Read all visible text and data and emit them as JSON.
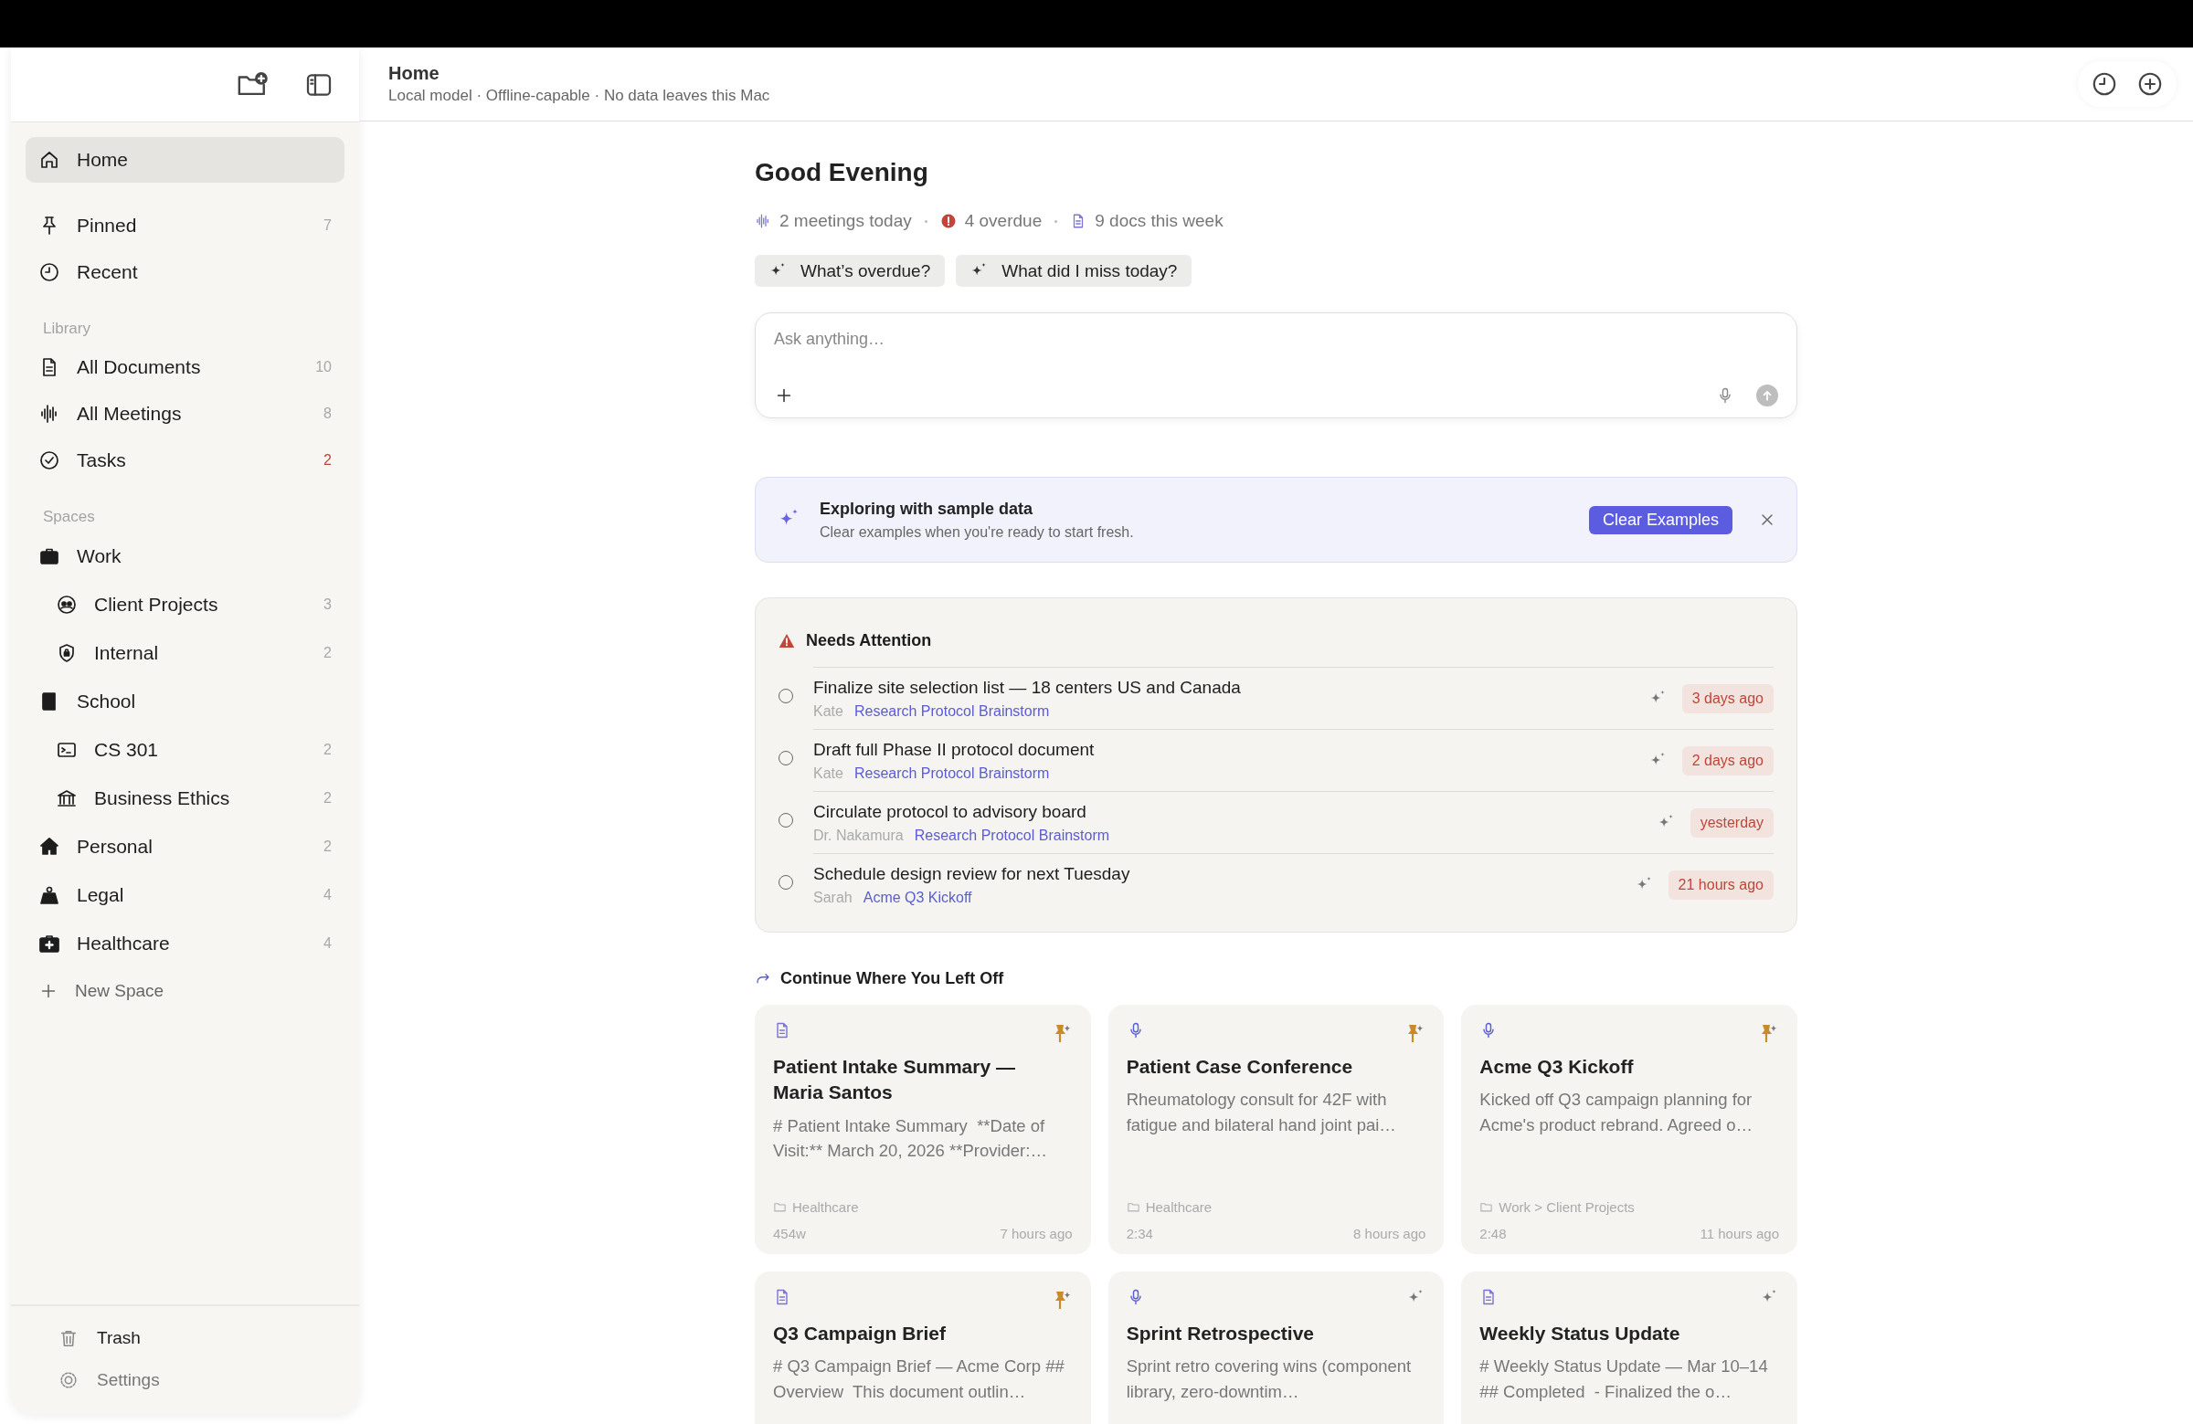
{
  "sidebar": {
    "nav": [
      {
        "label": "Home",
        "selected": true
      },
      {
        "label": "Pinned",
        "count": "7",
        "count_alert": false,
        "selected": false
      },
      {
        "label": "Recent",
        "selected": false
      }
    ],
    "sections": [
      {
        "title": "Library",
        "items": [
          {
            "label": "All Documents",
            "count": "10",
            "count_alert": false,
            "selected": false
          },
          {
            "label": "All Meetings",
            "count": "8",
            "count_alert": false,
            "selected": false
          },
          {
            "label": "Tasks",
            "count": "2",
            "count_alert": true,
            "selected": false
          }
        ]
      },
      {
        "title": "Spaces",
        "items": [
          {
            "label": "Work",
            "selected": false,
            "children": [
              {
                "label": "Client Projects",
                "count": "3",
                "count_alert": false,
                "selected": false
              },
              {
                "label": "Internal",
                "count": "2",
                "count_alert": false,
                "selected": false
              }
            ]
          },
          {
            "label": "School",
            "selected": false,
            "children": [
              {
                "label": "CS 301",
                "count": "2",
                "count_alert": false,
                "selected": false
              },
              {
                "label": "Business Ethics",
                "count": "2",
                "count_alert": false,
                "selected": false
              }
            ]
          },
          {
            "label": "Personal",
            "count": "2",
            "count_alert": false,
            "selected": false
          },
          {
            "label": "Legal",
            "count": "4",
            "count_alert": false,
            "selected": false
          },
          {
            "label": "Healthcare",
            "count": "4",
            "count_alert": false,
            "selected": false
          }
        ]
      }
    ],
    "new_space": "New Space",
    "footer": [
      {
        "label": "Trash"
      },
      {
        "label": "Settings"
      }
    ]
  },
  "header": {
    "title": "Home",
    "subtitle": "Local model · Offline-capable · No data leaves this Mac"
  },
  "greeting": "Good Evening",
  "stats": [
    {
      "kind": "meetings",
      "text": "2 meetings today"
    },
    {
      "kind": "overdue",
      "text": "4 overdue"
    },
    {
      "kind": "docs",
      "text": "9 docs this week"
    }
  ],
  "suggestions": [
    "What’s overdue?",
    "What did I miss today?"
  ],
  "composer": {
    "placeholder": "Ask anything…"
  },
  "banner": {
    "title": "Exploring with sample data",
    "text": "Clear examples when you're ready to start fresh.",
    "button": "Clear Examples"
  },
  "attention": {
    "title": "Needs Attention",
    "items": [
      {
        "title": "Finalize site selection list — 18 centers US and Canada",
        "person": "Kate",
        "source": "Research Protocol Brainstorm",
        "due": "3 days ago",
        "checked": false
      },
      {
        "title": "Draft full Phase II protocol document",
        "person": "Kate",
        "source": "Research Protocol Brainstorm",
        "due": "2 days ago",
        "checked": false
      },
      {
        "title": "Circulate protocol to advisory board",
        "person": "Dr. Nakamura",
        "source": "Research Protocol Brainstorm",
        "due": "yesterday",
        "checked": false
      },
      {
        "title": "Schedule design review for next Tuesday",
        "person": "Sarah",
        "source": "Acme Q3 Kickoff",
        "due": "21 hours ago",
        "checked": false
      }
    ]
  },
  "continue": {
    "title": "Continue Where You Left Off",
    "cards": [
      {
        "kind": "document",
        "pinned": true,
        "title": "Patient Intake Summary — Maria Santos",
        "preview": "# Patient Intake Summary  **Date of Visit:** March 20, 2026 **Provider:…",
        "folder": "Healthcare",
        "meta": "454w",
        "time": "7 hours ago"
      },
      {
        "kind": "meeting",
        "pinned": true,
        "title": "Patient Case Conference",
        "preview": "Rheumatology consult for 42F with fatigue and bilateral hand joint pai…",
        "folder": "Healthcare",
        "meta": "2:34",
        "time": "8 hours ago"
      },
      {
        "kind": "meeting",
        "pinned": true,
        "title": "Acme Q3 Kickoff",
        "preview": "Kicked off Q3 campaign planning for Acme's product rebrand. Agreed o…",
        "folder": "Work > Client Projects",
        "meta": "2:48",
        "time": "11 hours ago"
      },
      {
        "kind": "document",
        "pinned": true,
        "title": "Q3 Campaign Brief",
        "preview": "# Q3 Campaign Brief — Acme Corp ## Overview  This document outlin…"
      },
      {
        "kind": "meeting",
        "pinned": false,
        "title": "Sprint Retrospective",
        "preview": "Sprint retro covering wins (component library, zero-downtim…"
      },
      {
        "kind": "document",
        "pinned": false,
        "title": "Weekly Status Update",
        "preview": "# Weekly Status Update — Mar 10–14  ## Completed  - Finalized the o…"
      }
    ]
  }
}
